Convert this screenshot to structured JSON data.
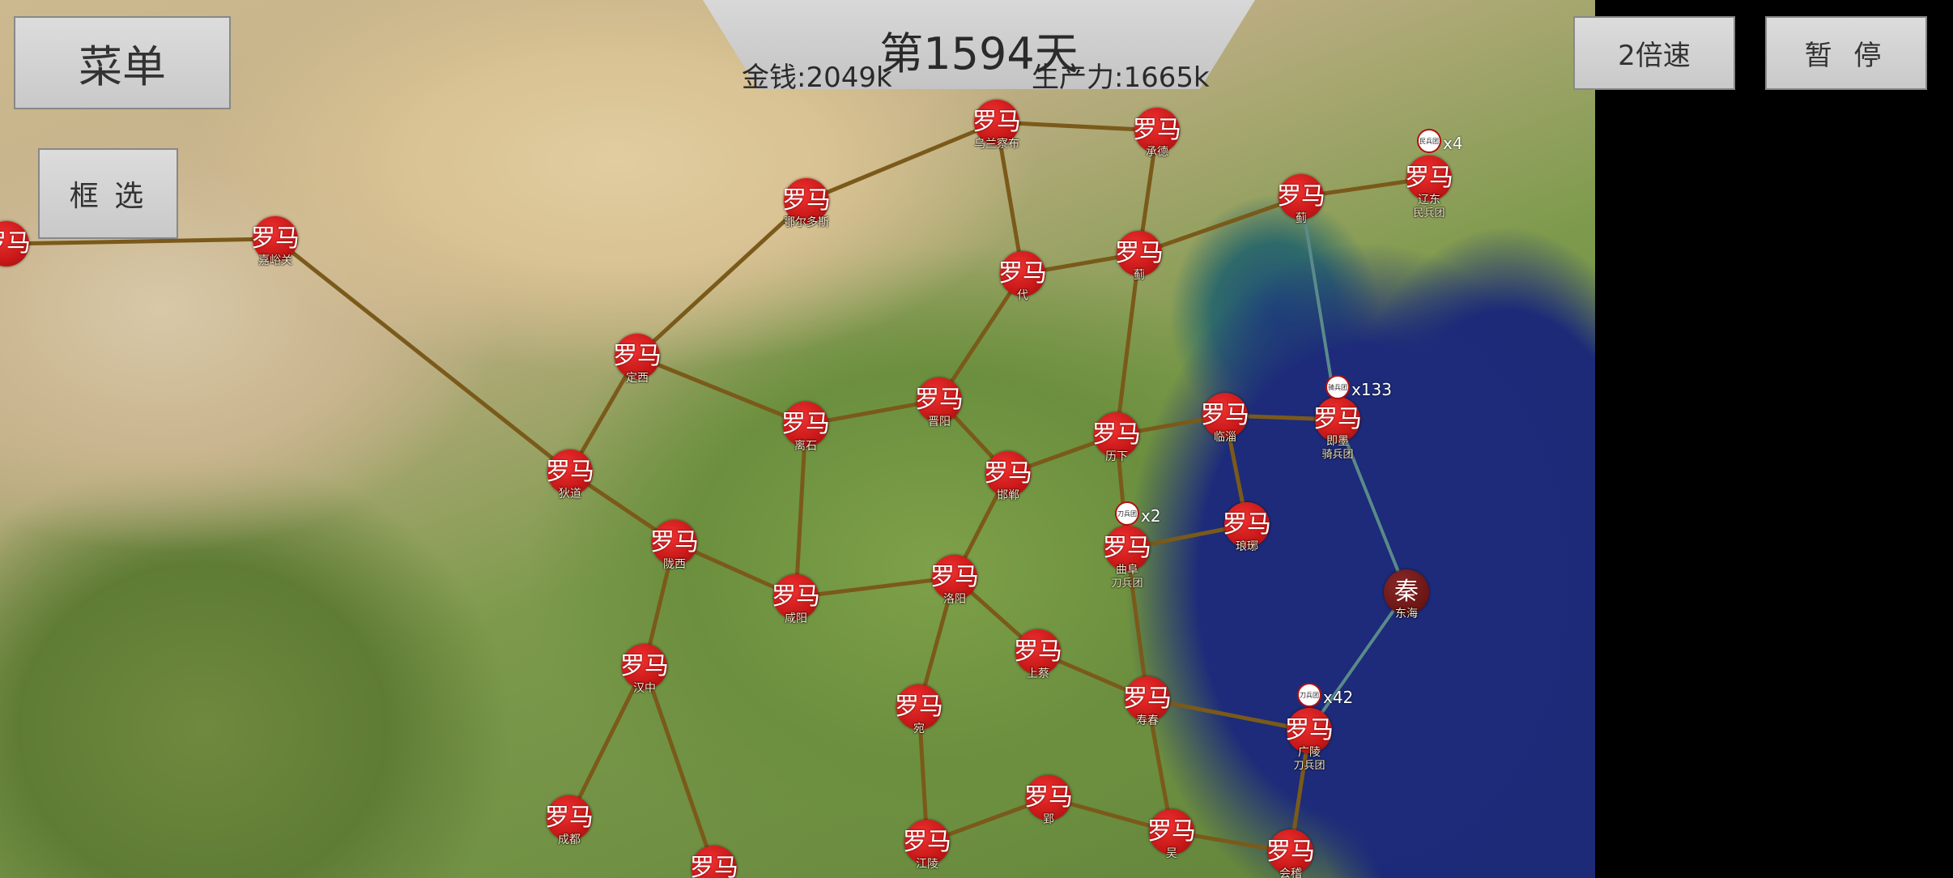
{
  "hud": {
    "menu_label": "菜单",
    "select_label": "框 选",
    "speed_label": "2倍速",
    "pause_label": "暂 停",
    "day_label": "第1594天",
    "money_label": "金钱:2049k",
    "production_label": "生产力:1665k"
  },
  "colors": {
    "roman_city": "#c81818",
    "qin_city": "#6a1414",
    "route": "#7a5a1a",
    "sea_route": "#5a8a8a",
    "button_bg": "#d0d0d0"
  },
  "cities": [
    {
      "id": "c1",
      "owner": "罗马",
      "name": "乌兰察布"
    },
    {
      "id": "c2",
      "owner": "罗马",
      "name": "承德"
    },
    {
      "id": "c3",
      "owner": "罗马",
      "name": "鄂尔多斯"
    },
    {
      "id": "c4",
      "owner": "罗马",
      "name": "蓟"
    },
    {
      "id": "c5",
      "owner": "罗马",
      "name": "辽东"
    },
    {
      "id": "c6",
      "owner": "罗马",
      "name": "代"
    },
    {
      "id": "c7",
      "owner": "罗马",
      "name": "蓟"
    },
    {
      "id": "c8",
      "owner": "罗马",
      "name": "嘉峪关"
    },
    {
      "id": "c9",
      "owner": "罗马",
      "name": ""
    },
    {
      "id": "c10",
      "owner": "罗马",
      "name": "定西"
    },
    {
      "id": "c11",
      "owner": "罗马",
      "name": "晋阳"
    },
    {
      "id": "c12",
      "owner": "罗马",
      "name": "离石"
    },
    {
      "id": "c13",
      "owner": "罗马",
      "name": "历下"
    },
    {
      "id": "c14",
      "owner": "罗马",
      "name": "临淄"
    },
    {
      "id": "c15",
      "owner": "罗马",
      "name": "即墨"
    },
    {
      "id": "c16",
      "owner": "罗马",
      "name": "邯郸"
    },
    {
      "id": "c17",
      "owner": "罗马",
      "name": "狄道"
    },
    {
      "id": "c18",
      "owner": "罗马",
      "name": "陇西"
    },
    {
      "id": "c19",
      "owner": "罗马",
      "name": "琅琊"
    },
    {
      "id": "c20",
      "owner": "罗马",
      "name": "曲阜"
    },
    {
      "id": "c21",
      "owner": "罗马",
      "name": "咸阳"
    },
    {
      "id": "c22",
      "owner": "罗马",
      "name": "洛阳"
    },
    {
      "id": "c23",
      "owner": "秦",
      "name": "东海"
    },
    {
      "id": "c24",
      "owner": "罗马",
      "name": "上蔡"
    },
    {
      "id": "c25",
      "owner": "罗马",
      "name": "汉中"
    },
    {
      "id": "c26",
      "owner": "罗马",
      "name": "宛"
    },
    {
      "id": "c27",
      "owner": "罗马",
      "name": "寿春"
    },
    {
      "id": "c28",
      "owner": "罗马",
      "name": "广陵"
    },
    {
      "id": "c29",
      "owner": "罗马",
      "name": "成都"
    },
    {
      "id": "c30",
      "owner": "罗马",
      "name": "郢"
    },
    {
      "id": "c31",
      "owner": "罗马",
      "name": "江陵"
    },
    {
      "id": "c32",
      "owner": "罗马",
      "name": "吴"
    },
    {
      "id": "c33",
      "owner": "罗马",
      "name": "会稽"
    },
    {
      "id": "c34",
      "owner": "罗马",
      "name": ""
    }
  ],
  "city_notes": [
    {
      "city": "c5",
      "text": "民兵团"
    },
    {
      "city": "c15",
      "text": "骑兵团"
    },
    {
      "city": "c20",
      "text": "刀兵团"
    },
    {
      "city": "c28",
      "text": "刀兵团"
    }
  ],
  "armies": [
    {
      "id": "a1",
      "flag": "民兵团",
      "count": "x4"
    },
    {
      "id": "a2",
      "flag": "骑兵团",
      "count": "x133"
    },
    {
      "id": "a3",
      "flag": "刀兵团",
      "count": "x2"
    },
    {
      "id": "a4",
      "flag": "刀兵团",
      "count": "x42"
    }
  ]
}
